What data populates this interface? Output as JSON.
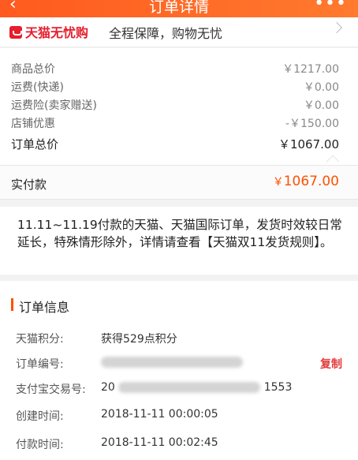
{
  "header": {
    "back_icon": "chevron-left-icon",
    "title": "订单详情",
    "more_icon": "more-dots-icon",
    "more_text": "•••"
  },
  "banner": {
    "brand": "天猫无忧购",
    "slogan": "全程保障，购物无忧"
  },
  "price_summary": {
    "rows": [
      {
        "label": "商品总价",
        "value": "￥1217.00"
      },
      {
        "label": "运费(快递)",
        "value": "￥0.00"
      },
      {
        "label": "运费险(卖家赠送)",
        "value": "￥0.00"
      },
      {
        "label": "店铺优惠",
        "value": "-￥150.00"
      }
    ],
    "total_label": "订单总价",
    "total_value": "￥1067.00"
  },
  "paid": {
    "label": "实付款",
    "currency": "￥",
    "amount": "1067.00"
  },
  "notice": "11.11~11.19付款的天猫、天猫国际订单，发货时效较日常延长，特殊情形除外，详情请查看【天猫双11发货规则】。",
  "order_info": {
    "title": "订单信息",
    "points_label": "天猫积分:",
    "points_value": "获得529点积分",
    "order_no_label": "订单编号:",
    "copy_label": "复制",
    "alipay_label": "支付宝交易号:",
    "alipay_prefix": "20",
    "alipay_suffix": "1553",
    "created_label": "创建时间:",
    "created_value": "2018-11-11 00:00:05",
    "paid_label": "付款时间:",
    "paid_value": "2018-11-11 00:02:45"
  },
  "colors": {
    "accent": "#ff5000",
    "header": "#ff6a22",
    "brand_red": "#e61e2d",
    "copy_red": "#e4393c"
  }
}
